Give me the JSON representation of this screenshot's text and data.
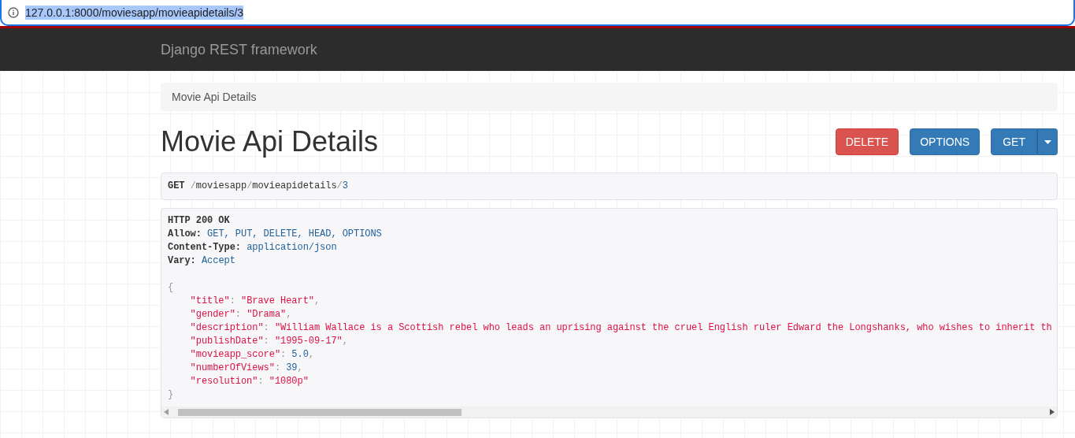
{
  "address_bar": {
    "url": "127.0.0.1:8000/moviesapp/movieapidetails/3",
    "selected": true
  },
  "navbar": {
    "brand": "Django REST framework"
  },
  "breadcrumb": [
    "Movie Api Details"
  ],
  "page_title": "Movie Api Details",
  "buttons": [
    {
      "label": "DELETE",
      "kind": "danger"
    },
    {
      "label": "OPTIONS",
      "kind": "primary"
    },
    {
      "label": "GET",
      "kind": "split"
    }
  ],
  "request": {
    "method": "GET",
    "path": [
      {
        "text": "/",
        "kind": "sep"
      },
      {
        "text": "moviesapp",
        "kind": "seg"
      },
      {
        "text": "/",
        "kind": "sep"
      },
      {
        "text": "movieapidetails",
        "kind": "seg"
      },
      {
        "text": "/",
        "kind": "sep"
      },
      {
        "text": "3",
        "kind": "num"
      }
    ]
  },
  "response": {
    "status": "HTTP 200 OK",
    "headers": [
      {
        "name": "Allow:",
        "value": "GET, PUT, DELETE, HEAD, OPTIONS"
      },
      {
        "name": "Content-Type:",
        "value": "application/json"
      },
      {
        "name": "Vary:",
        "value": "Accept"
      }
    ],
    "open": "{",
    "close": "}",
    "separator": ":",
    "fields": [
      {
        "key": "\"title\"",
        "value": "\"Brave Heart\"",
        "kind": "string",
        "trail": ","
      },
      {
        "key": "\"gender\"",
        "value": "\"Drama\"",
        "kind": "string",
        "trail": ","
      },
      {
        "key": "\"description\"",
        "value": "\"William Wallace is a Scottish rebel who leads an uprising against the cruel English ruler Edward the Longshanks, who wishes to inherit th",
        "kind": "string"
      },
      {
        "key": "\"publishDate\"",
        "value": "\"1995-09-17\"",
        "kind": "string",
        "trail": ","
      },
      {
        "key": "\"movieapp_score\"",
        "value": "5.0",
        "kind": "number",
        "trail": ","
      },
      {
        "key": "\"numberOfViews\"",
        "value": "39",
        "kind": "number",
        "trail": ","
      },
      {
        "key": "\"resolution\"",
        "value": "\"1080p\"",
        "kind": "string"
      }
    ]
  }
}
